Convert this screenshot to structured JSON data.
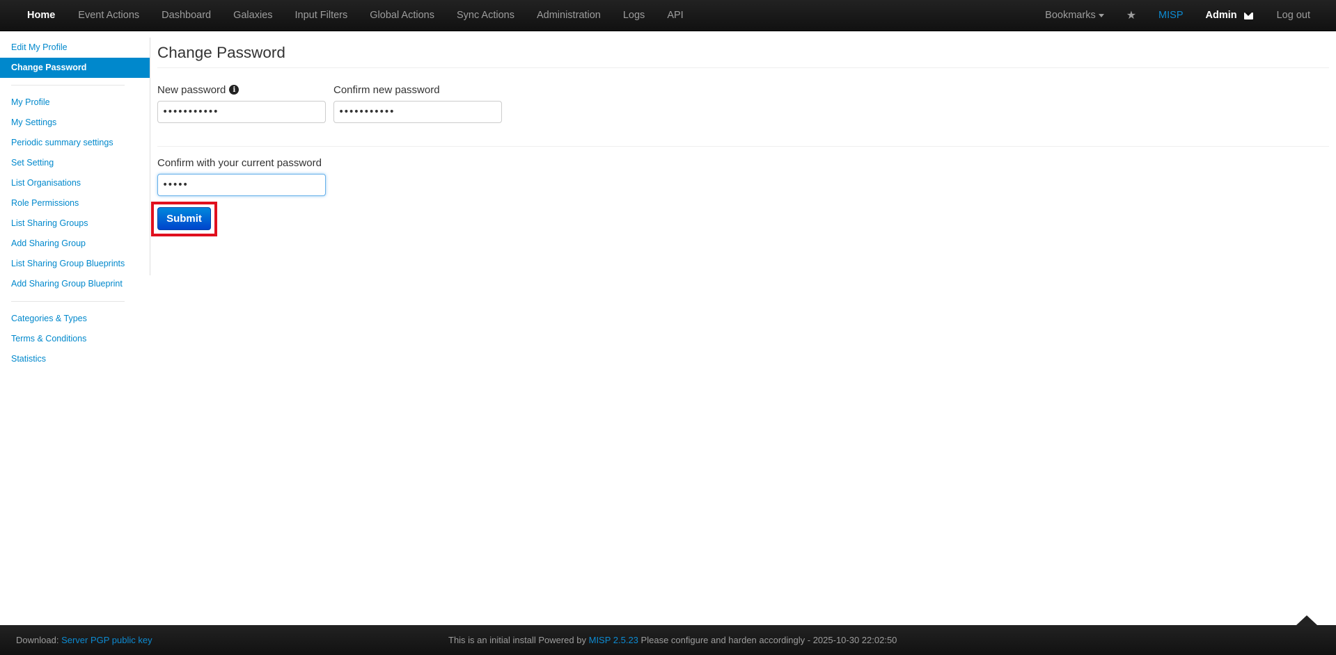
{
  "navbar": {
    "left": [
      {
        "label": "Home"
      },
      {
        "label": "Event Actions"
      },
      {
        "label": "Dashboard"
      },
      {
        "label": "Galaxies"
      },
      {
        "label": "Input Filters"
      },
      {
        "label": "Global Actions"
      },
      {
        "label": "Sync Actions"
      },
      {
        "label": "Administration"
      },
      {
        "label": "Logs"
      },
      {
        "label": "API"
      }
    ],
    "bookmarks": "Bookmarks",
    "brand": "MISP",
    "user": "Admin",
    "logout": "Log out",
    "brand_color": "#0d8bd2"
  },
  "sidebar": {
    "group1": [
      {
        "label": "Edit My Profile"
      },
      {
        "label": "Change Password"
      }
    ],
    "group2": [
      {
        "label": "My Profile"
      },
      {
        "label": "My Settings"
      },
      {
        "label": "Periodic summary settings"
      },
      {
        "label": "Set Setting"
      },
      {
        "label": "List Organisations"
      },
      {
        "label": "Role Permissions"
      },
      {
        "label": "List Sharing Groups"
      },
      {
        "label": "Add Sharing Group"
      },
      {
        "label": "List Sharing Group Blueprints"
      },
      {
        "label": "Add Sharing Group Blueprint"
      }
    ],
    "group3": [
      {
        "label": "Categories & Types"
      },
      {
        "label": "Terms & Conditions"
      },
      {
        "label": "Statistics"
      }
    ],
    "active_color": "#0088cc"
  },
  "main": {
    "title": "Change Password",
    "new_password": {
      "label": "New password",
      "value": "•••••••••••"
    },
    "confirm_password": {
      "label": "Confirm new password",
      "value": "•••••••••••"
    },
    "current_password": {
      "label": "Confirm with your current password",
      "value": "•••••"
    },
    "submit": "Submit"
  },
  "footer": {
    "download_label": "Download:",
    "pgp_link": "Server PGP public key",
    "text_before": "This is an initial install Powered by",
    "version_link": "MISP 2.5.23",
    "text_after": "Please configure and harden accordingly - 2025-10-30 22:02:50"
  }
}
